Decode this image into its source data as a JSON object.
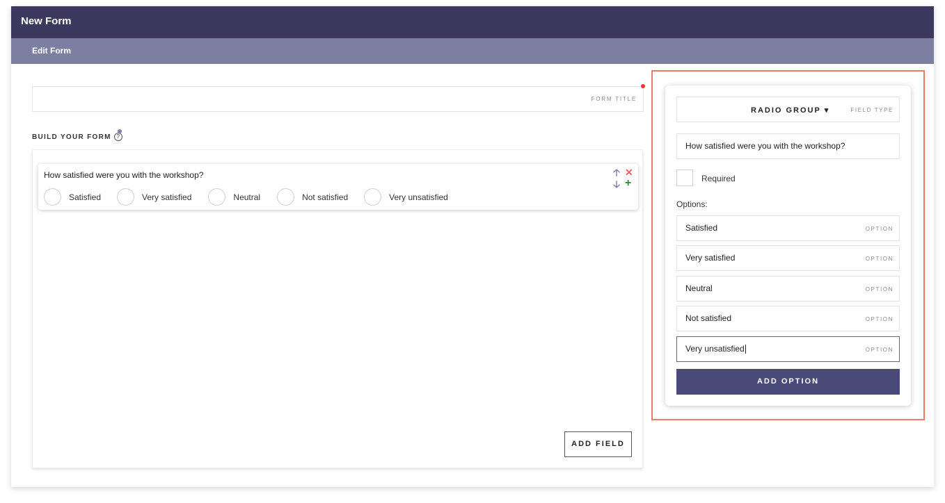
{
  "header": {
    "title": "New Form",
    "subtitle": "Edit Form"
  },
  "form_title": {
    "placeholder": "FORM TITLE"
  },
  "builder": {
    "label": "BUILD YOUR FORM",
    "help_glyph": "?",
    "add_field_label": "ADD FIELD",
    "field": {
      "question": "How satisfied were you with the workshop?",
      "options": [
        "Satisfied",
        "Very satisfied",
        "Neutral",
        "Not satisfied",
        "Very unsatisfied"
      ],
      "controls": {
        "up": "🡡",
        "delete": "✕",
        "down": "🡣",
        "add": "+"
      }
    }
  },
  "editor": {
    "field_type_value": "RADIO GROUP ▾",
    "field_type_hint": "FIELD TYPE",
    "question_value": "How satisfied were you with the workshop?",
    "required_label": "Required",
    "options_label": "Options:",
    "option_hint": "OPTION",
    "options": [
      "Satisfied",
      "Very satisfied",
      "Neutral",
      "Not satisfied",
      "Very unsatisfied"
    ],
    "add_option_label": "ADD OPTION"
  },
  "colors": {
    "topbar": "#3d385d",
    "subbar": "#7d7fa1",
    "accent_button": "#4b4b7a",
    "highlight": "#ef7b63"
  },
  "icons": {
    "up": "arrow-up-icon",
    "delete": "close-icon",
    "down": "arrow-down-icon",
    "add": "plus-icon",
    "help": "help-icon"
  }
}
